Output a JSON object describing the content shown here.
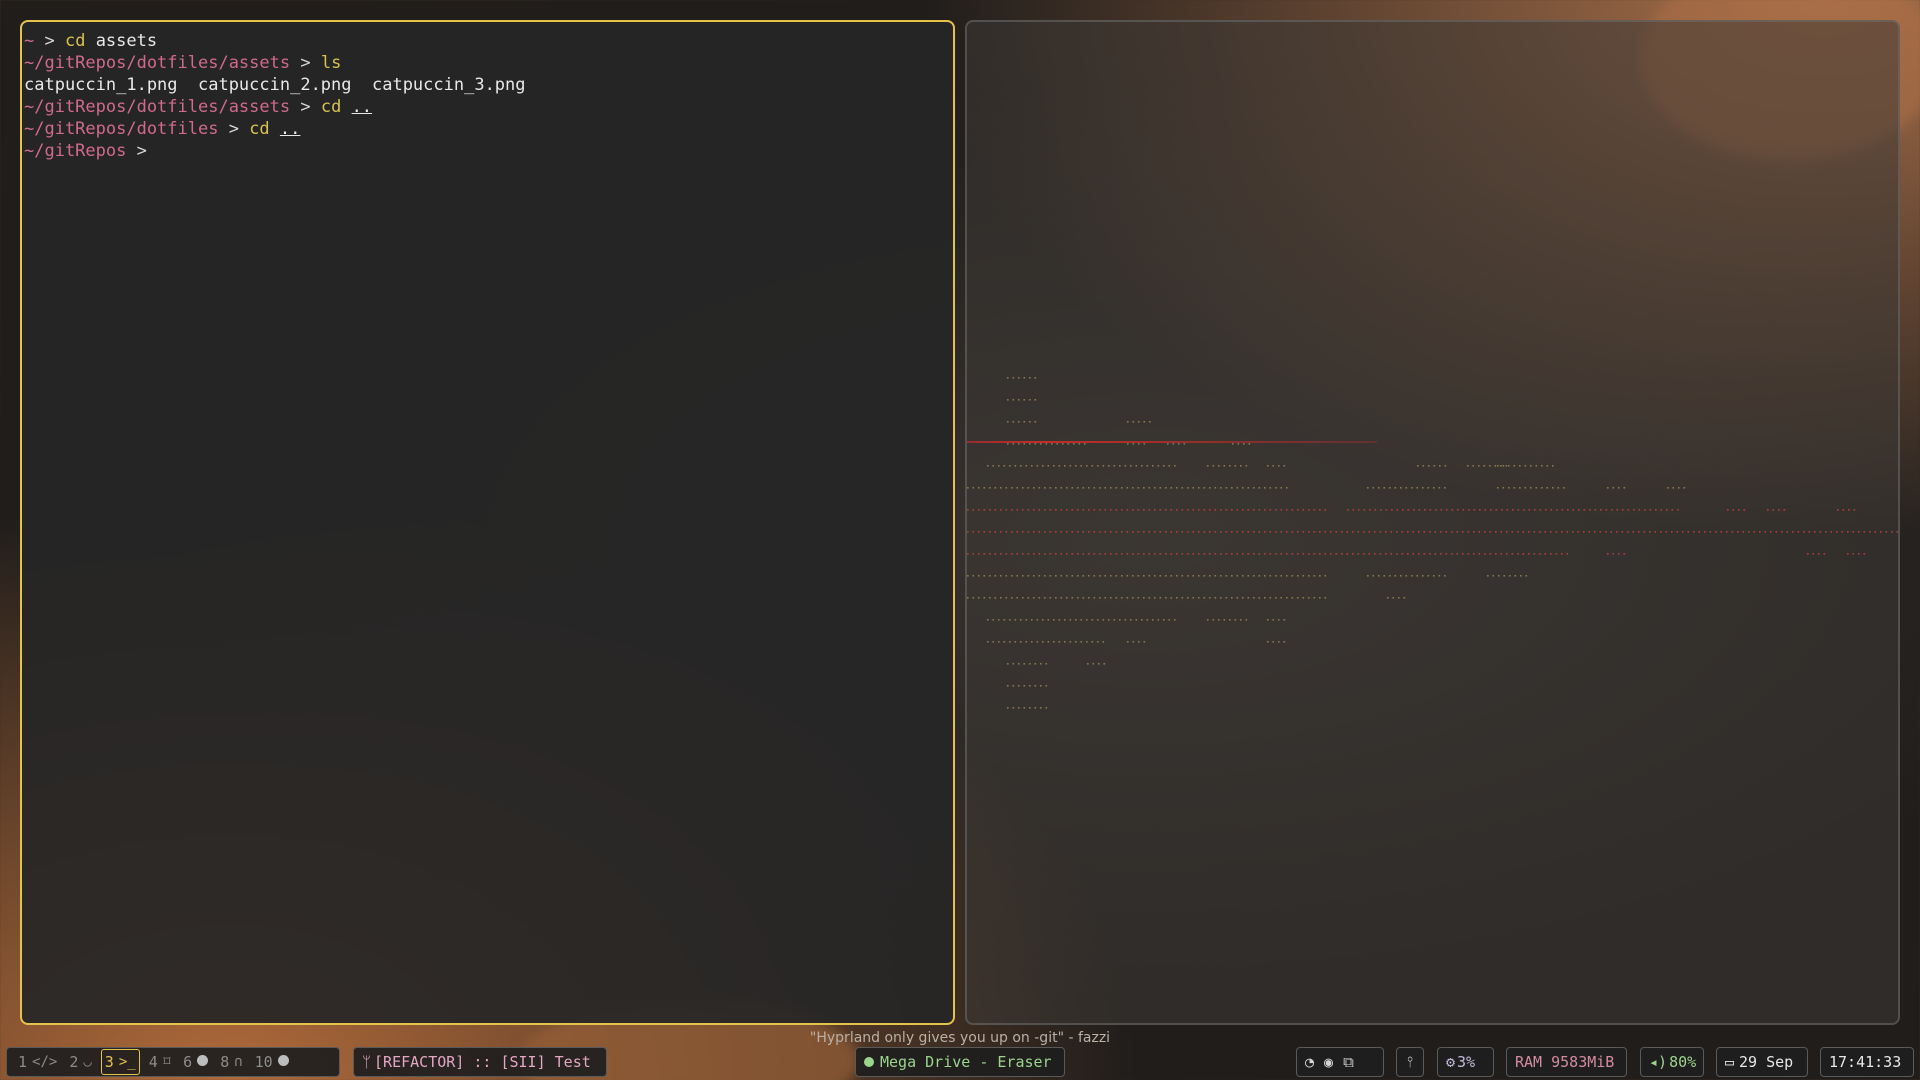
{
  "terminal": {
    "lines": [
      {
        "prompt": "~",
        "arrow": " > ",
        "cmd": "cd",
        "arg": " assets",
        "out": ""
      },
      {
        "prompt": "~/gitRepos/dotfiles/assets",
        "arrow": " > ",
        "cmd": "ls",
        "arg": "",
        "out": ""
      },
      {
        "prompt": "",
        "arrow": "",
        "cmd": "",
        "arg": "",
        "out": "catpuccin_1.png  catpuccin_2.png  catpuccin_3.png"
      },
      {
        "prompt": "~/gitRepos/dotfiles/assets",
        "arrow": " > ",
        "cmd": "cd",
        "arg": " ..",
        "out": ""
      },
      {
        "prompt": "~/gitRepos/dotfiles",
        "arrow": " > ",
        "cmd": "cd",
        "arg": " ..",
        "out": ""
      },
      {
        "prompt": "~/gitRepos",
        "arrow": " > ",
        "cmd": "",
        "arg": "",
        "out": ""
      }
    ]
  },
  "bar": {
    "quote": "\"Hyprland only gives you up on -git\" - fazzi",
    "workspaces": [
      {
        "num": "1",
        "icon": "</>",
        "icon_name": "code-icon",
        "active": false
      },
      {
        "num": "2",
        "icon": "◡",
        "icon_name": "steam-icon",
        "active": false
      },
      {
        "num": "3",
        "icon": ">_",
        "icon_name": "terminal-icon",
        "active": true
      },
      {
        "num": "4",
        "icon": "⌑",
        "icon_name": "discord-icon",
        "active": false
      },
      {
        "num": "6",
        "icon": "●",
        "icon_name": "circle-icon",
        "active": false
      },
      {
        "num": "8",
        "icon": "∩",
        "icon_name": "headphones-icon",
        "active": false
      },
      {
        "num": "10",
        "icon": "●",
        "icon_name": "circle-icon",
        "active": false
      }
    ],
    "git_status": "[REFACTOR] :: [SII] Test",
    "media": "Mega Drive - Eraser",
    "tray_icons": [
      "steam-icon",
      "chromium-icon",
      "window-icon"
    ],
    "pin_icon": "pin-icon",
    "cpu": "3%",
    "ram": "RAM 9583MiB",
    "volume": "80%",
    "date": "29 Sep",
    "clock": "17:41:33"
  }
}
